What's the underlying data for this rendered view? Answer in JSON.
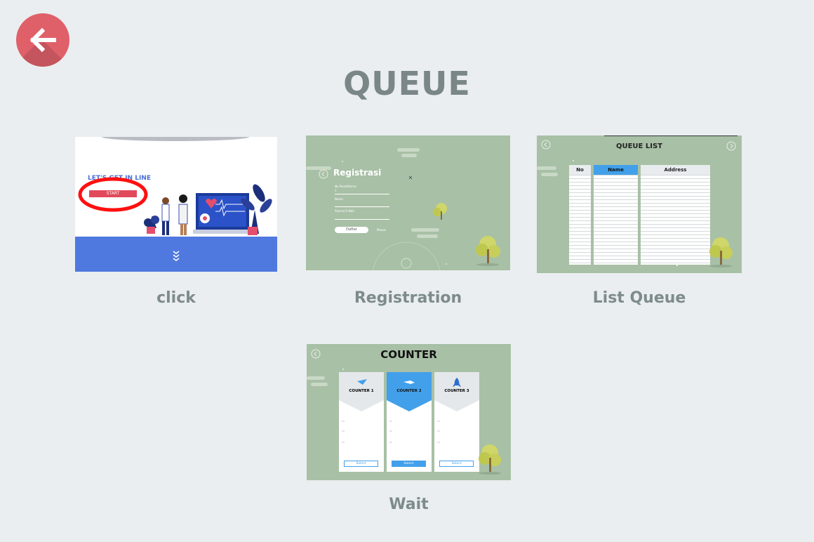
{
  "header": {
    "back_icon": "arrow-left-icon",
    "back_color": "#e0606a",
    "title": "QUEUE"
  },
  "cards": [
    {
      "caption": "click",
      "thumb": {
        "headline": "LET'S GET IN LINE",
        "button": "START"
      }
    },
    {
      "caption": "Registration",
      "thumb": {
        "title": "Registrasi",
        "fields": [
          "No Pendaftaran",
          "Nama",
          "Alamat E-Mail"
        ],
        "field_value": "1",
        "button": "Daftar",
        "link": "Masuk"
      }
    },
    {
      "caption": "List Queue",
      "thumb": {
        "title": "QUEUE LIST",
        "columns": [
          "No",
          "Name",
          "Address"
        ]
      }
    },
    {
      "caption": "Wait",
      "thumb": {
        "title": "COUNTER",
        "counters": [
          "COUNTER 1",
          "COUNTER 2",
          "COUNTER 3"
        ],
        "select_label": "Select"
      }
    }
  ],
  "colors": {
    "background": "#eaeef0",
    "title": "#7a8688",
    "thumb_green": "#a8c0a6",
    "accent_blue": "#42a0ea"
  }
}
